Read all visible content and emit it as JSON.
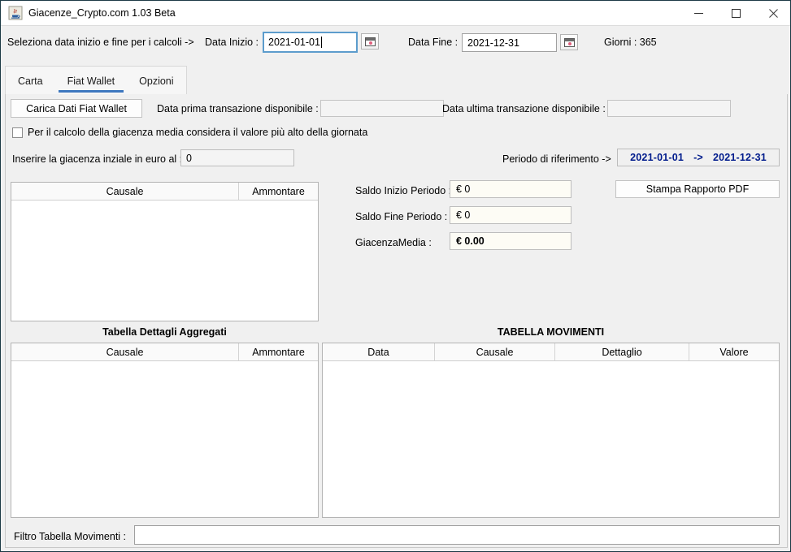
{
  "window": {
    "title": "Giacenze_Crypto.com 1.03 Beta",
    "app_icon": "java-coffee-cup-icon",
    "controls": {
      "minimize": "–",
      "maximize": "□",
      "close": "✕"
    }
  },
  "topbar": {
    "instruction": "Seleziona data inizio e fine per i calcoli ->",
    "data_inizio_label": "Data Inizio :",
    "data_inizio_value": "2021-01-01",
    "data_fine_label": "Data Fine :",
    "data_fine_value": "2021-12-31",
    "giorni_label": "Giorni : 365",
    "calendar_icon": "calendar-icon"
  },
  "tabs": [
    {
      "label": "Carta",
      "selected": false
    },
    {
      "label": "Fiat Wallet",
      "selected": true
    },
    {
      "label": "Opzioni",
      "selected": false
    }
  ],
  "panel": {
    "load_button": "Carica Dati Fiat Wallet",
    "first_tx_label": "Data prima transazione disponibile :",
    "first_tx_value": "",
    "last_tx_label": "Data ultima transazione disponibile :",
    "last_tx_value": "",
    "checkbox_label": "Per il calcolo della giacenza media considera il valore più alto della giornata",
    "checkbox_checked": false,
    "initial_balance_label": "Inserire la giacenza inziale in euro al :",
    "initial_balance_value": "0",
    "period_label": "Periodo di riferimento ->",
    "period_from": "2021-01-01",
    "period_arrow": "->",
    "period_to": "2021-12-31",
    "saldo_inizio_label": "Saldo Inizio Periodo :",
    "saldo_inizio_value": "€ 0",
    "saldo_fine_label": "Saldo Fine Periodo :",
    "saldo_fine_value": "€ 0",
    "giacenza_media_label": "GiacenzaMedia :",
    "giacenza_media_value": "€ 0.00",
    "pdf_button": "Stampa Rapporto PDF",
    "filter_label": "Filtro Tabella Movimenti :",
    "filter_value": ""
  },
  "tables": {
    "top_left": {
      "headers": [
        "Causale",
        "Ammontare"
      ],
      "rows": []
    },
    "bottom_left": {
      "title": "Tabella Dettagli Aggregati",
      "headers": [
        "Causale",
        "Ammontare"
      ],
      "rows": []
    },
    "bottom_right": {
      "title": "TABELLA MOVIMENTI",
      "headers": [
        "Data",
        "Causale",
        "Dettaglio",
        "Valore"
      ],
      "rows": []
    }
  },
  "colors": {
    "accent": "#3d77bf",
    "period_text": "#001b8c",
    "window_border": "#1c3a45",
    "panel_bg": "#f0f0f0"
  }
}
